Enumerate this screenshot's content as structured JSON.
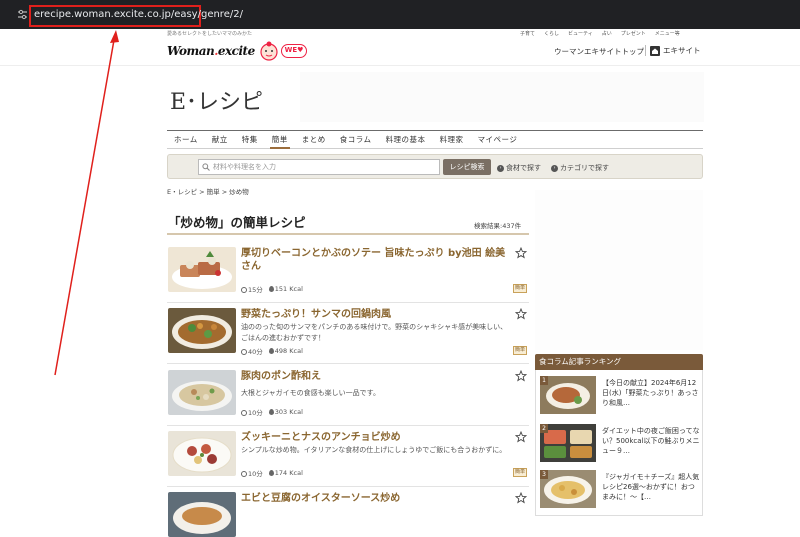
{
  "browser": {
    "url": "erecipe.woman.excite.co.jp/easy/genre/2/"
  },
  "header": {
    "tagline": "愛あるセレクトをしたいママのみかた",
    "util_links": [
      "子育て",
      "くらし",
      "ビューティ",
      "占い",
      "プレゼント",
      "メニュー等"
    ],
    "logo_text_1": "Woman",
    "logo_text_2": "excite",
    "we_badge": "WE♥",
    "top_link": "ウーマンエキサイトトップ",
    "excite_link": "エキサイト"
  },
  "site_title": "E･レシピ",
  "nav": {
    "items": [
      "ホーム",
      "献立",
      "特集",
      "簡単",
      "まとめ",
      "食コラム",
      "料理の基本",
      "料理家",
      "マイページ"
    ],
    "active_index": 3
  },
  "search": {
    "placeholder": "材料や料理名を入力",
    "button": "レシピ検索",
    "link_food": "食材で探す",
    "link_category": "カテゴリで探す"
  },
  "breadcrumb": "E・レシピ > 簡単 > 炒め物",
  "page": {
    "heading": "「炒め物」の簡単レシピ",
    "result_count": "検索結果:437件"
  },
  "recipes": [
    {
      "title": "厚切りベーコンとかぶのソテー 旨味たっぷり by池田 絵美さん",
      "desc": "",
      "time": "15分",
      "kcal": "151 Kcal",
      "tag": "簡単"
    },
    {
      "title": "野菜たっぷり！サンマの回鍋肉風",
      "desc": "油ののった旬のサンマをパンチのある味付けで。野菜のシャキシャキ感が美味しい、ごはんの進むおかずです！",
      "time": "40分",
      "kcal": "498 Kcal",
      "tag": "簡単"
    },
    {
      "title": "豚肉のポン酢和え",
      "desc": "大根とジャガイモの食感も楽しい一品です。",
      "time": "10分",
      "kcal": "303 Kcal",
      "tag": "簡単"
    },
    {
      "title": "ズッキーニとナスのアンチョビ炒め",
      "desc": "シンプルな炒め物。イタリアンな食材の仕上げにしょうゆでご飯にも合うおかずに。",
      "time": "10分",
      "kcal": "174 Kcal",
      "tag": "簡単"
    },
    {
      "title": "エビと豆腐のオイスターソース炒め",
      "desc": "",
      "time": "",
      "kcal": "",
      "tag": ""
    }
  ],
  "ranking": {
    "title": "食コラム記事ランキング",
    "items": [
      {
        "num": "1",
        "text": "【今日の献立】2024年6月12日(水)「野菜たっぷり！あっさり和風…"
      },
      {
        "num": "2",
        "text": "ダイエット中の夜ご飯困ってない？500kcal以下の鮭ぶりメニュー９…"
      },
      {
        "num": "3",
        "text": "『ジャガイモ＋チーズ』超人気レシピ26選～おかずに！おつまみに！～【…"
      }
    ]
  },
  "colors": {
    "accent_brown": "#8a6630",
    "annotation_red": "#e0201c"
  }
}
